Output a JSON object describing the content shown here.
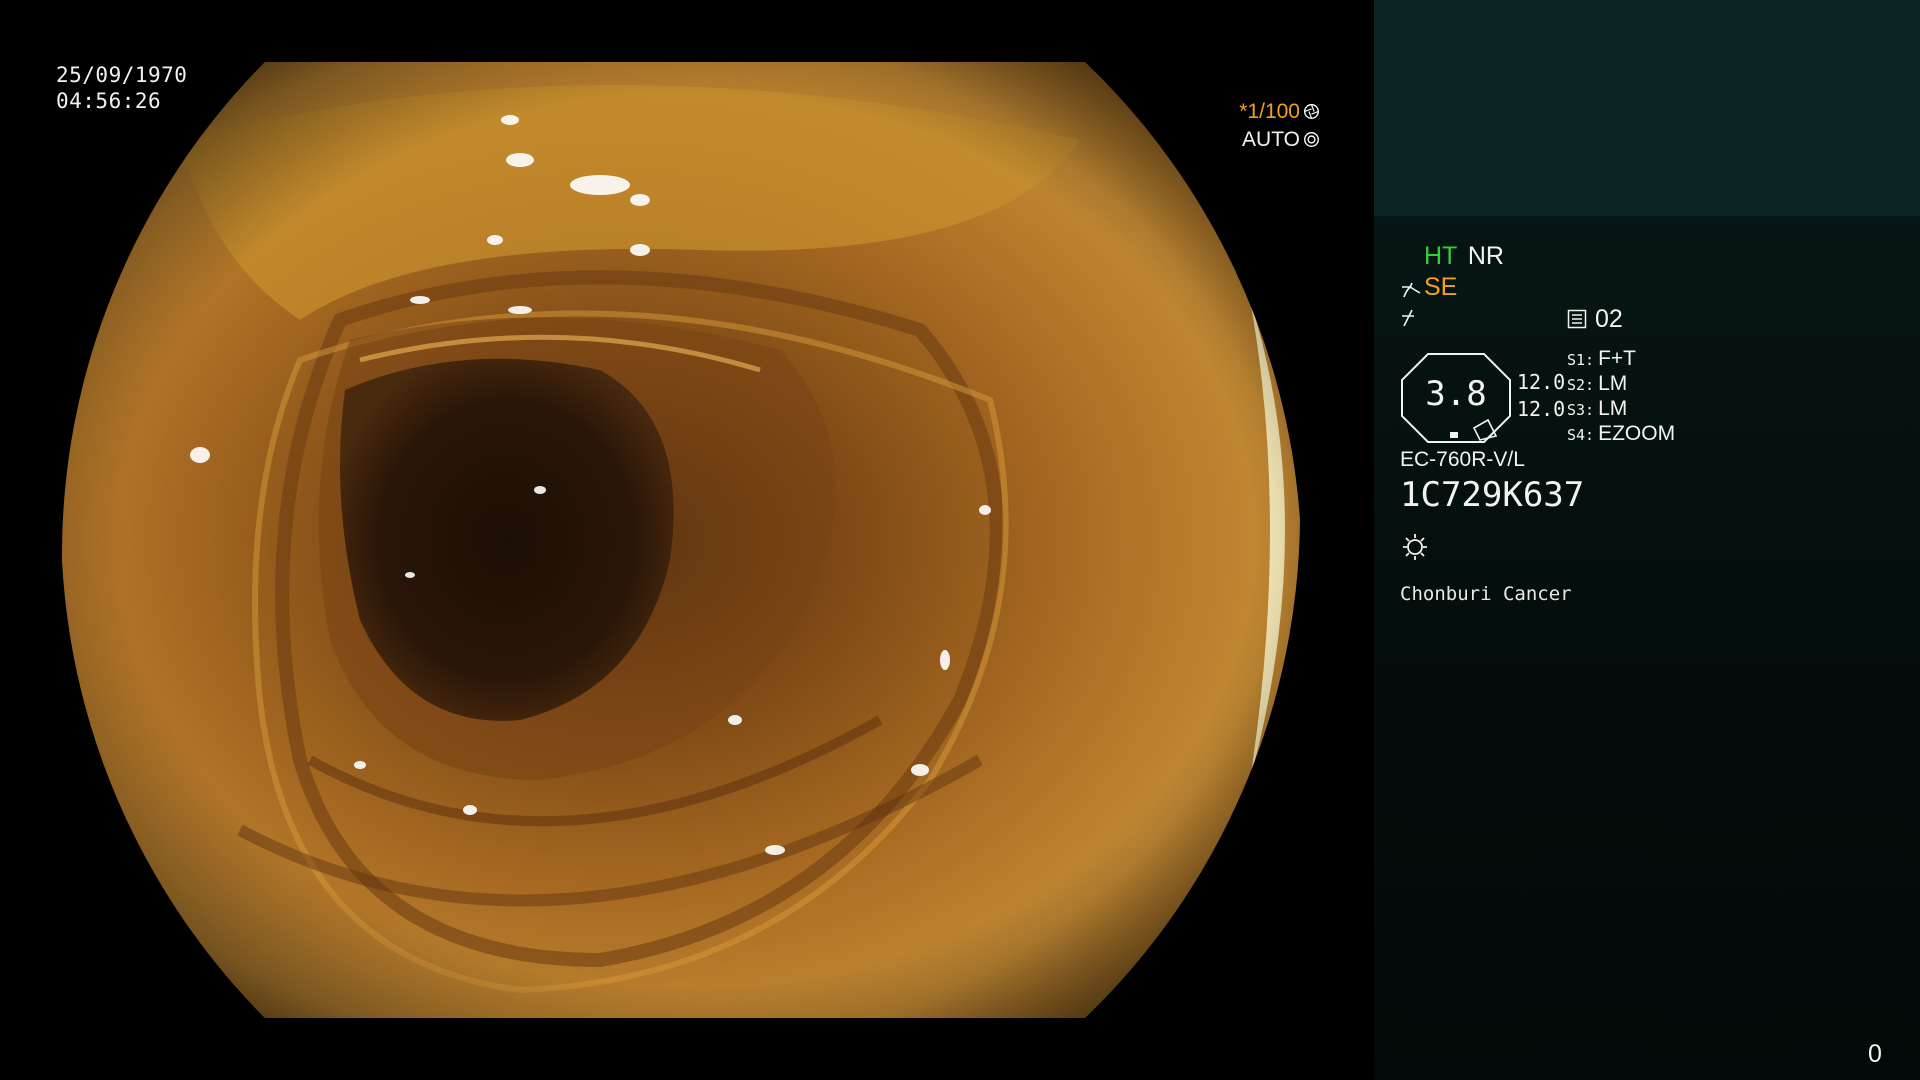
{
  "overlay": {
    "date": "25/09/1970",
    "time": "04:56:26",
    "shutter_speed": "*1/100",
    "exposure_mode": "AUTO"
  },
  "panel": {
    "mode_ht": "HT",
    "mode_nr": "NR",
    "mode_se": "SE",
    "memory_number": "02",
    "gauge_value": "3.8",
    "gauge_side_top": "12.0",
    "gauge_side_bottom": "12.0",
    "switches": [
      {
        "key": "S1:",
        "value": "F+T"
      },
      {
        "key": "S2:",
        "value": "LM"
      },
      {
        "key": "S3:",
        "value": "LM"
      },
      {
        "key": "S4:",
        "value": "EZOOM"
      }
    ],
    "scope_model": "EC-760R-V/L",
    "serial_number": "1C729K637",
    "institution": "Chonburi Cancer",
    "counter": "0"
  },
  "colors": {
    "accent_green": "#30d03a",
    "accent_orange": "#f0a020",
    "panel_bg": "#040e0d"
  },
  "icons": [
    "shutter-icon",
    "auto-exposure-icon",
    "structure-enhance-icon",
    "freeze-icon",
    "memory-card-icon",
    "light-source-icon"
  ]
}
